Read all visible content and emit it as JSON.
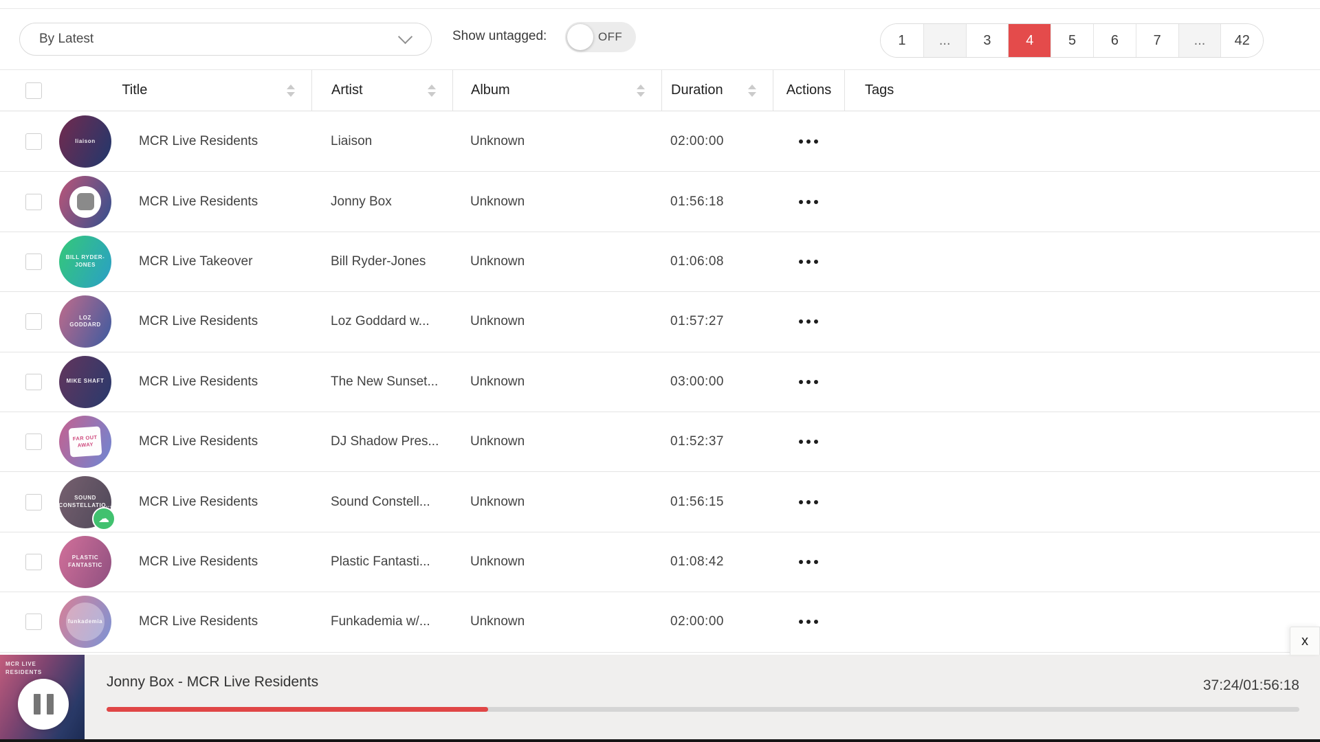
{
  "colors": {
    "accent_red": "#e44b4b",
    "progress_red": "#e04646",
    "mixcloud_green": "#41c16f"
  },
  "toolbar": {
    "sort": {
      "value": "By Latest"
    },
    "untagged_label": "Show untagged:",
    "toggle_state": "OFF"
  },
  "pagination": {
    "pages": [
      {
        "label": "1"
      },
      {
        "label": "..."
      },
      {
        "label": "3"
      },
      {
        "label": "4",
        "active": true
      },
      {
        "label": "5"
      },
      {
        "label": "6"
      },
      {
        "label": "7"
      },
      {
        "label": "..."
      },
      {
        "label": "42"
      }
    ]
  },
  "table": {
    "columns": [
      {
        "label": "Title",
        "sortable": true
      },
      {
        "label": "Artist",
        "sortable": true
      },
      {
        "label": "Album",
        "sortable": true
      },
      {
        "label": "Duration",
        "sortable": true
      },
      {
        "label": "Actions",
        "sortable": false
      },
      {
        "label": "Tags",
        "sortable": false
      }
    ],
    "rows": [
      {
        "title": "MCR Live Residents",
        "artist": "Liaison",
        "album": "Unknown",
        "duration": "02:00:00",
        "art": {
          "label": "liaison",
          "from": "#732a4e",
          "to": "#20386d"
        }
      },
      {
        "title": "MCR Live Residents",
        "artist": "Jonny Box",
        "album": "Unknown",
        "duration": "01:56:18",
        "art": {
          "label": "",
          "from": "#bd5578",
          "to": "#32508e",
          "center": "stop"
        }
      },
      {
        "title": "MCR Live Takeover",
        "artist": "Bill Ryder-Jones",
        "album": "Unknown",
        "duration": "01:06:08",
        "art": {
          "label": "BILL RYDER-JONES",
          "from": "#35c878",
          "to": "#2a9fc7"
        }
      },
      {
        "title": "MCR Live Residents",
        "artist": "Loz Goddard w...",
        "album": "Unknown",
        "duration": "01:57:27",
        "art": {
          "label": "LOZ GODDARD",
          "from": "#c06b8b",
          "to": "#3c5ba0"
        }
      },
      {
        "title": "MCR Live Residents",
        "artist": "The New Sunset...",
        "album": "Unknown",
        "duration": "03:00:00",
        "art": {
          "label": "MIKE SHAFT",
          "from": "#63355c",
          "to": "#283a6d"
        }
      },
      {
        "title": "MCR Live Residents",
        "artist": "DJ Shadow Pres...",
        "album": "Unknown",
        "duration": "01:52:37",
        "art": {
          "label": "",
          "from": "#c5618f",
          "to": "#6d87d4",
          "center": "sticker",
          "sticker_text": "FAR OUT AWAY"
        }
      },
      {
        "title": "MCR Live Residents",
        "artist": "Sound Constell...",
        "album": "Unknown",
        "duration": "01:56:15",
        "art": {
          "label": "SOUND CONSTELLATIO...",
          "from": "#77606f",
          "to": "#4e4859",
          "badge": "mixcloud"
        }
      },
      {
        "title": "MCR Live Residents",
        "artist": "Plastic Fantasti...",
        "album": "Unknown",
        "duration": "01:08:42",
        "art": {
          "label": "PLASTIC FANTASTIC",
          "from": "#d2709a",
          "to": "#8f5080"
        }
      },
      {
        "title": "MCR Live Residents",
        "artist": "Funkademia w/...",
        "album": "Unknown",
        "duration": "02:00:00",
        "art": {
          "label": "funkademia",
          "from": "#d78097",
          "to": "#7b94d6",
          "center": "disc"
        }
      }
    ]
  },
  "player": {
    "track_title": "Jonny Box - MCR Live Residents",
    "time_display": "37:24/01:56:18",
    "progress_pct": 32,
    "state": "playing",
    "thumb_label": "MCR LIVE RESIDENTS",
    "close_label": "x"
  }
}
